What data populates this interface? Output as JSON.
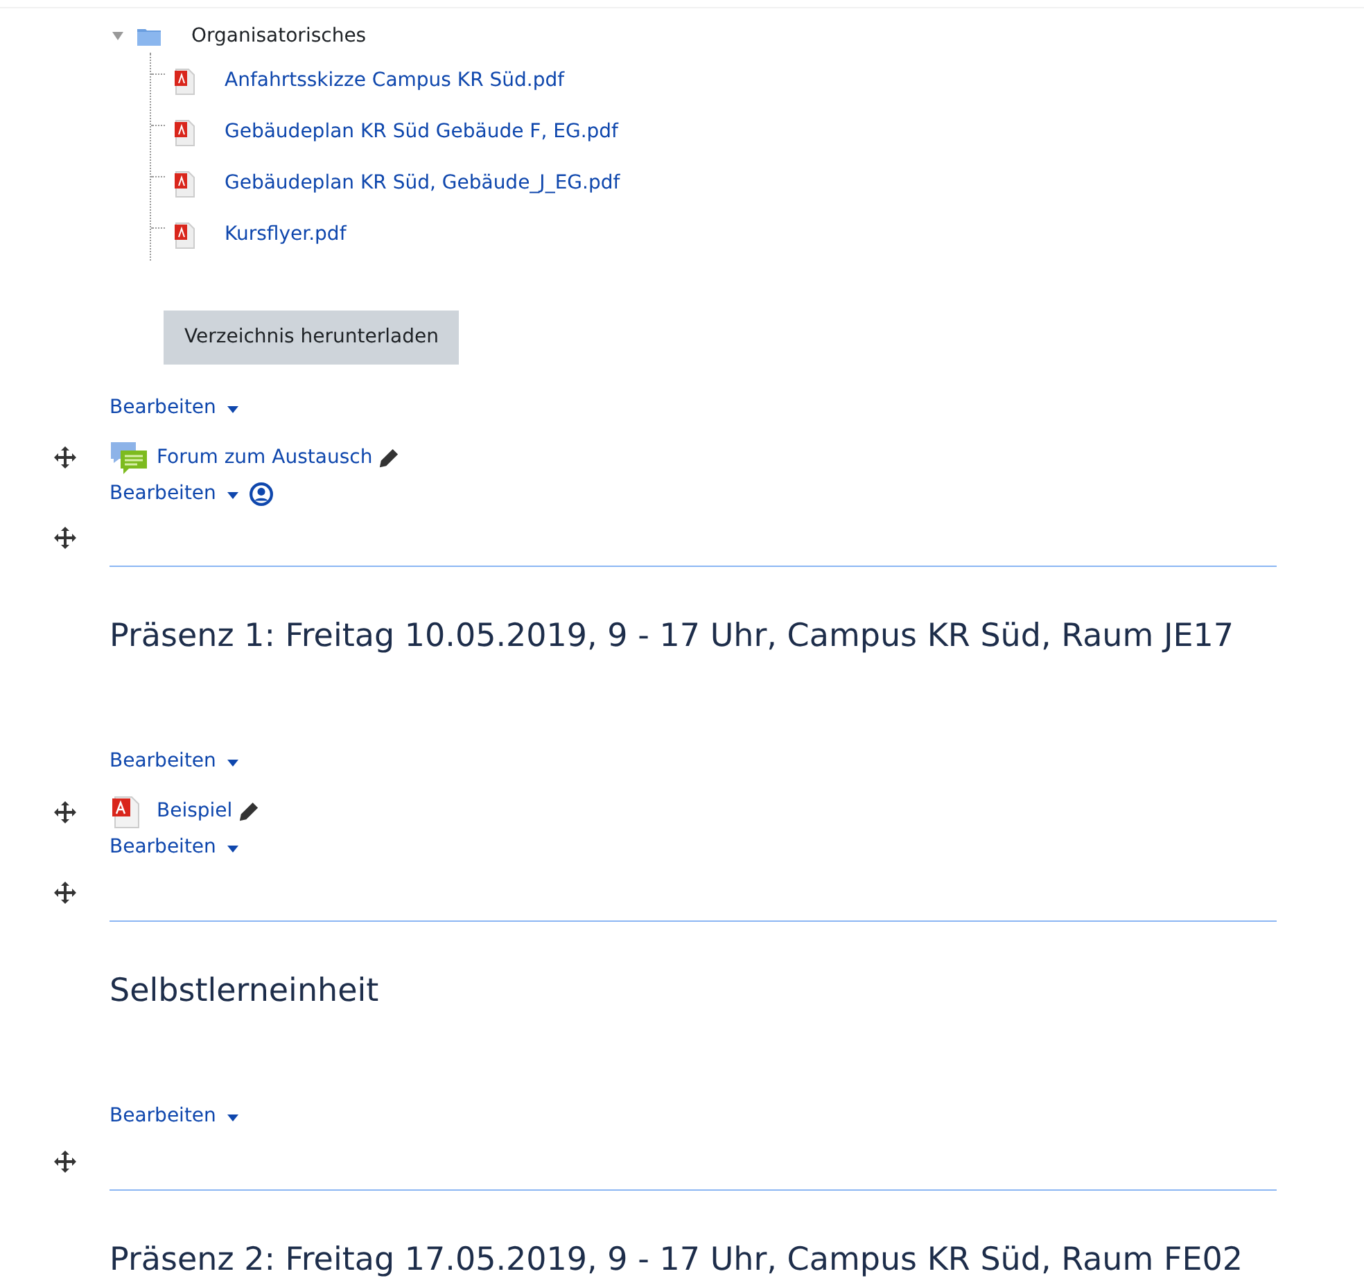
{
  "folder": {
    "name": "Organisatorisches",
    "expanded": true,
    "files": [
      {
        "name": "Anfahrtsskizze Campus KR Süd.pdf"
      },
      {
        "name": "Gebäudeplan KR Süd Gebäude F, EG.pdf"
      },
      {
        "name": "Gebäudeplan KR Süd, Gebäude_J_EG.pdf"
      },
      {
        "name": "Kursflyer.pdf"
      }
    ]
  },
  "download_button": "Verzeichnis herunterladen",
  "rows": [
    {
      "kind": "menu",
      "label": "Bearbeiten",
      "group_icon": false
    },
    {
      "kind": "forum",
      "title": "Forum zum Austausch"
    },
    {
      "kind": "menu",
      "label": "Bearbeiten",
      "group_icon": true
    },
    {
      "kind": "divider"
    },
    {
      "kind": "heading",
      "title": "Präsenz 1: Freitag 10.05.2019, 9 - 17 Uhr, Campus KR Süd, Raum  JE17"
    },
    {
      "kind": "menu",
      "label": "Bearbeiten",
      "group_icon": false
    },
    {
      "kind": "file",
      "title": "Beispiel"
    },
    {
      "kind": "menu",
      "label": "Bearbeiten",
      "group_icon": false
    },
    {
      "kind": "divider"
    },
    {
      "kind": "heading",
      "title": "Selbstlerneinheit"
    },
    {
      "kind": "menu",
      "label": "Bearbeiten",
      "group_icon": false
    },
    {
      "kind": "divider"
    },
    {
      "kind": "heading",
      "title": "Präsenz 2: Freitag 17.05.2019, 9 - 17 Uhr, Campus KR Süd, Raum  FE02"
    }
  ]
}
